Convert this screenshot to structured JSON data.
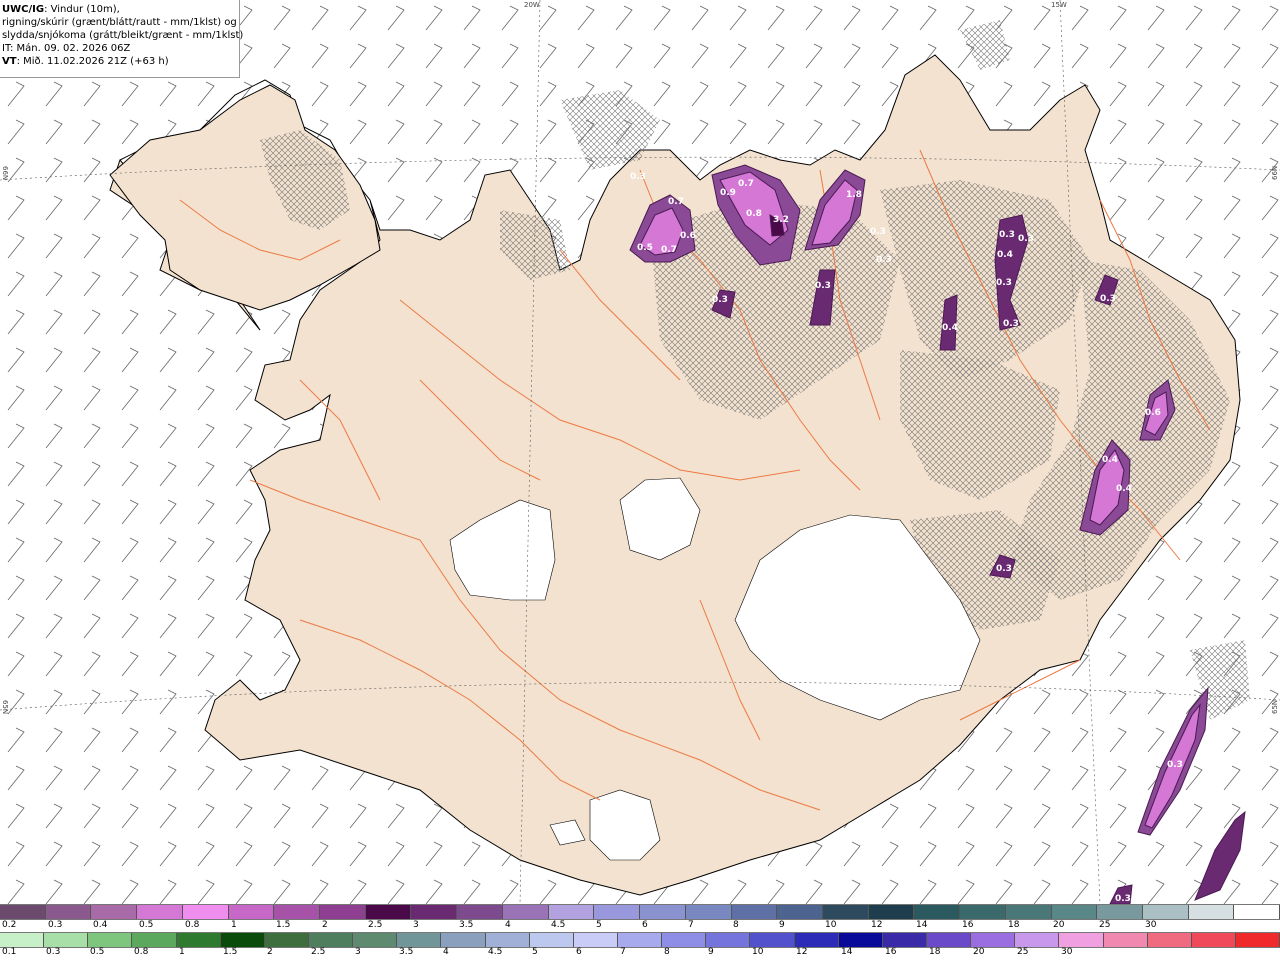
{
  "header": {
    "model": "UWC/IG",
    "line1_rest": ": Vindur (10m),",
    "line2": "rigning/skúrir (grænt/blátt/rautt - mm/1klst) og",
    "line3": "slydda/snjókoma (grátt/bleikt/grænt - mm/1klst)",
    "line4": "IT: Mán. 09. 02. 2026 06Z",
    "line5_label": "VT",
    "line5_rest": ": Mið. 11.02.2026 21Z (+63 h)"
  },
  "grid_labels": {
    "top_20w": "20W",
    "top_15w": "15W",
    "left_66n": "66N",
    "left_65n": "65N",
    "right_66n": "66N",
    "right_65n": "65N"
  },
  "snow_labels": [
    "0.3",
    "0.7",
    "0.6",
    "0.5",
    "0.7",
    "0.9",
    "0.7",
    "0.8",
    "3.2",
    "1.8",
    "0.3",
    "0.3",
    "0.3",
    "0.3",
    "0.4",
    "0.4",
    "0.3",
    "0.3",
    "0.3",
    "0.6",
    "0.4",
    "0.4",
    "0.3",
    "0.3",
    "0.3",
    "0.3",
    "0.3"
  ],
  "legend": {
    "snow_colors": [
      "#6b4a6e",
      "#8a5a8e",
      "#a96aa8",
      "#d577d5",
      "#f08ef0",
      "#c768c8",
      "#a552a8",
      "#8e3f92",
      "#4a0a4a",
      "#6a2a72",
      "#7e4a8e",
      "#9a72b6",
      "#b2a2e0",
      "#9a98dc",
      "#8a92d0",
      "#7a88c2",
      "#5e70a6",
      "#4e6490",
      "#2e4a5e",
      "#1e3e4e",
      "#2a5a60",
      "#3a6a6c",
      "#4a7878",
      "#5a8888",
      "#789a9e",
      "#aac0c4",
      "#d6e0e2",
      "#ffffff"
    ],
    "snow_ticks": [
      "0.2",
      "0.3",
      "0.4",
      "0.5",
      "0.8",
      "1",
      "1.5",
      "2",
      "2.5",
      "3",
      "3.5",
      "4",
      "4.5",
      "5",
      "6",
      "7",
      "8",
      "9",
      "10",
      "12",
      "14",
      "16",
      "18",
      "20",
      "25",
      "30"
    ],
    "rain_colors": [
      "#c8f0c8",
      "#a8dea8",
      "#7ec67e",
      "#5ca85c",
      "#2e7a2e",
      "#0a4a0a",
      "#3e6e3e",
      "#4e7e5e",
      "#5e8a70",
      "#70969a",
      "#8aa0bc",
      "#a0b0d6",
      "#bcc8ee",
      "#c8ccf6",
      "#a8aaee",
      "#8e8ee6",
      "#7474dc",
      "#5252cc",
      "#2c2cb8",
      "#0a0a9a",
      "#3a2aa8",
      "#6a4ac8",
      "#9a6ee0",
      "#c898ec",
      "#f0a0e0",
      "#f088b0",
      "#f06a80",
      "#f04a5a",
      "#f02a2a"
    ],
    "rain_ticks": [
      "0.1",
      "0.3",
      "0.5",
      "0.8",
      "1",
      "1.5",
      "2",
      "2.5",
      "3",
      "3.5",
      "4",
      "4.5",
      "5",
      "6",
      "7",
      "8",
      "9",
      "10",
      "12",
      "14",
      "16",
      "18",
      "20",
      "25",
      "30"
    ]
  },
  "colors": {
    "land": "#f3e2cf",
    "road": "#ec7a45",
    "coast": "#000000",
    "glacier": "#ffffff",
    "snow_dark": "#6a2a72",
    "snow_light": "#d577d5"
  }
}
